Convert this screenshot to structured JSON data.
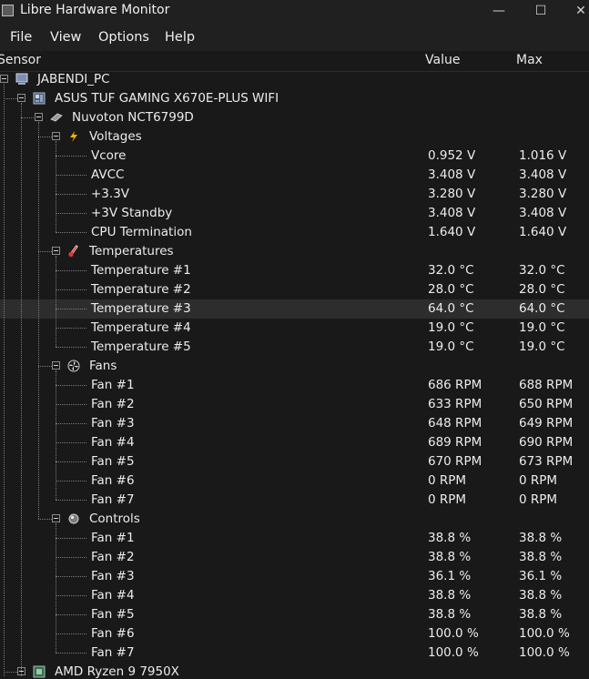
{
  "window": {
    "title": "Libre Hardware Monitor",
    "minimize_glyph": "—",
    "maximize_glyph": "☐",
    "close_glyph": "✕"
  },
  "menu": [
    "File",
    "View",
    "Options",
    "Help"
  ],
  "columns": {
    "sensor": "Sensor",
    "value": "Value",
    "max": "Max"
  },
  "tree": {
    "computer": "JABENDI_PC",
    "motherboard": "ASUS TUF GAMING X670E-PLUS WIFI",
    "chip": "Nuvoton NCT6799D",
    "groups": [
      {
        "name": "Voltages",
        "icon": "lightning-icon",
        "sensors": [
          {
            "name": "Vcore",
            "value": "0.952 V",
            "max": "1.016 V"
          },
          {
            "name": "AVCC",
            "value": "3.408 V",
            "max": "3.408 V"
          },
          {
            "name": "+3.3V",
            "value": "3.280 V",
            "max": "3.280 V"
          },
          {
            "name": "+3V Standby",
            "value": "3.408 V",
            "max": "3.408 V"
          },
          {
            "name": "CPU Termination",
            "value": "1.640 V",
            "max": "1.640 V"
          }
        ]
      },
      {
        "name": "Temperatures",
        "icon": "thermometer-icon",
        "sensors": [
          {
            "name": "Temperature #1",
            "value": "32.0 °C",
            "max": "32.0 °C"
          },
          {
            "name": "Temperature #2",
            "value": "28.0 °C",
            "max": "28.0 °C"
          },
          {
            "name": "Temperature #3",
            "value": "64.0 °C",
            "max": "64.0 °C"
          },
          {
            "name": "Temperature #4",
            "value": "19.0 °C",
            "max": "19.0 °C"
          },
          {
            "name": "Temperature #5",
            "value": "19.0 °C",
            "max": "19.0 °C"
          }
        ]
      },
      {
        "name": "Fans",
        "icon": "fan-icon",
        "sensors": [
          {
            "name": "Fan #1",
            "value": "686 RPM",
            "max": "688 RPM"
          },
          {
            "name": "Fan #2",
            "value": "633 RPM",
            "max": "650 RPM"
          },
          {
            "name": "Fan #3",
            "value": "648 RPM",
            "max": "649 RPM"
          },
          {
            "name": "Fan #4",
            "value": "689 RPM",
            "max": "690 RPM"
          },
          {
            "name": "Fan #5",
            "value": "670 RPM",
            "max": "673 RPM"
          },
          {
            "name": "Fan #6",
            "value": "0 RPM",
            "max": "0 RPM"
          },
          {
            "name": "Fan #7",
            "value": "0 RPM",
            "max": "0 RPM"
          }
        ]
      },
      {
        "name": "Controls",
        "icon": "knob-icon",
        "sensors": [
          {
            "name": "Fan #1",
            "value": "38.8 %",
            "max": "38.8 %"
          },
          {
            "name": "Fan #2",
            "value": "38.8 %",
            "max": "38.8 %"
          },
          {
            "name": "Fan #3",
            "value": "36.1 %",
            "max": "36.1 %"
          },
          {
            "name": "Fan #4",
            "value": "38.8 %",
            "max": "38.8 %"
          },
          {
            "name": "Fan #5",
            "value": "38.8 %",
            "max": "38.8 %"
          },
          {
            "name": "Fan #6",
            "value": "100.0 %",
            "max": "100.0 %"
          },
          {
            "name": "Fan #7",
            "value": "100.0 %",
            "max": "100.0 %"
          }
        ]
      }
    ],
    "cpu": "AMD Ryzen 9 7950X",
    "selected_sensor": "Temperature #3"
  },
  "colors": {
    "background": "#191919",
    "chrome": "#202020",
    "selection": "#2d2d2d",
    "text": "#ececec"
  }
}
